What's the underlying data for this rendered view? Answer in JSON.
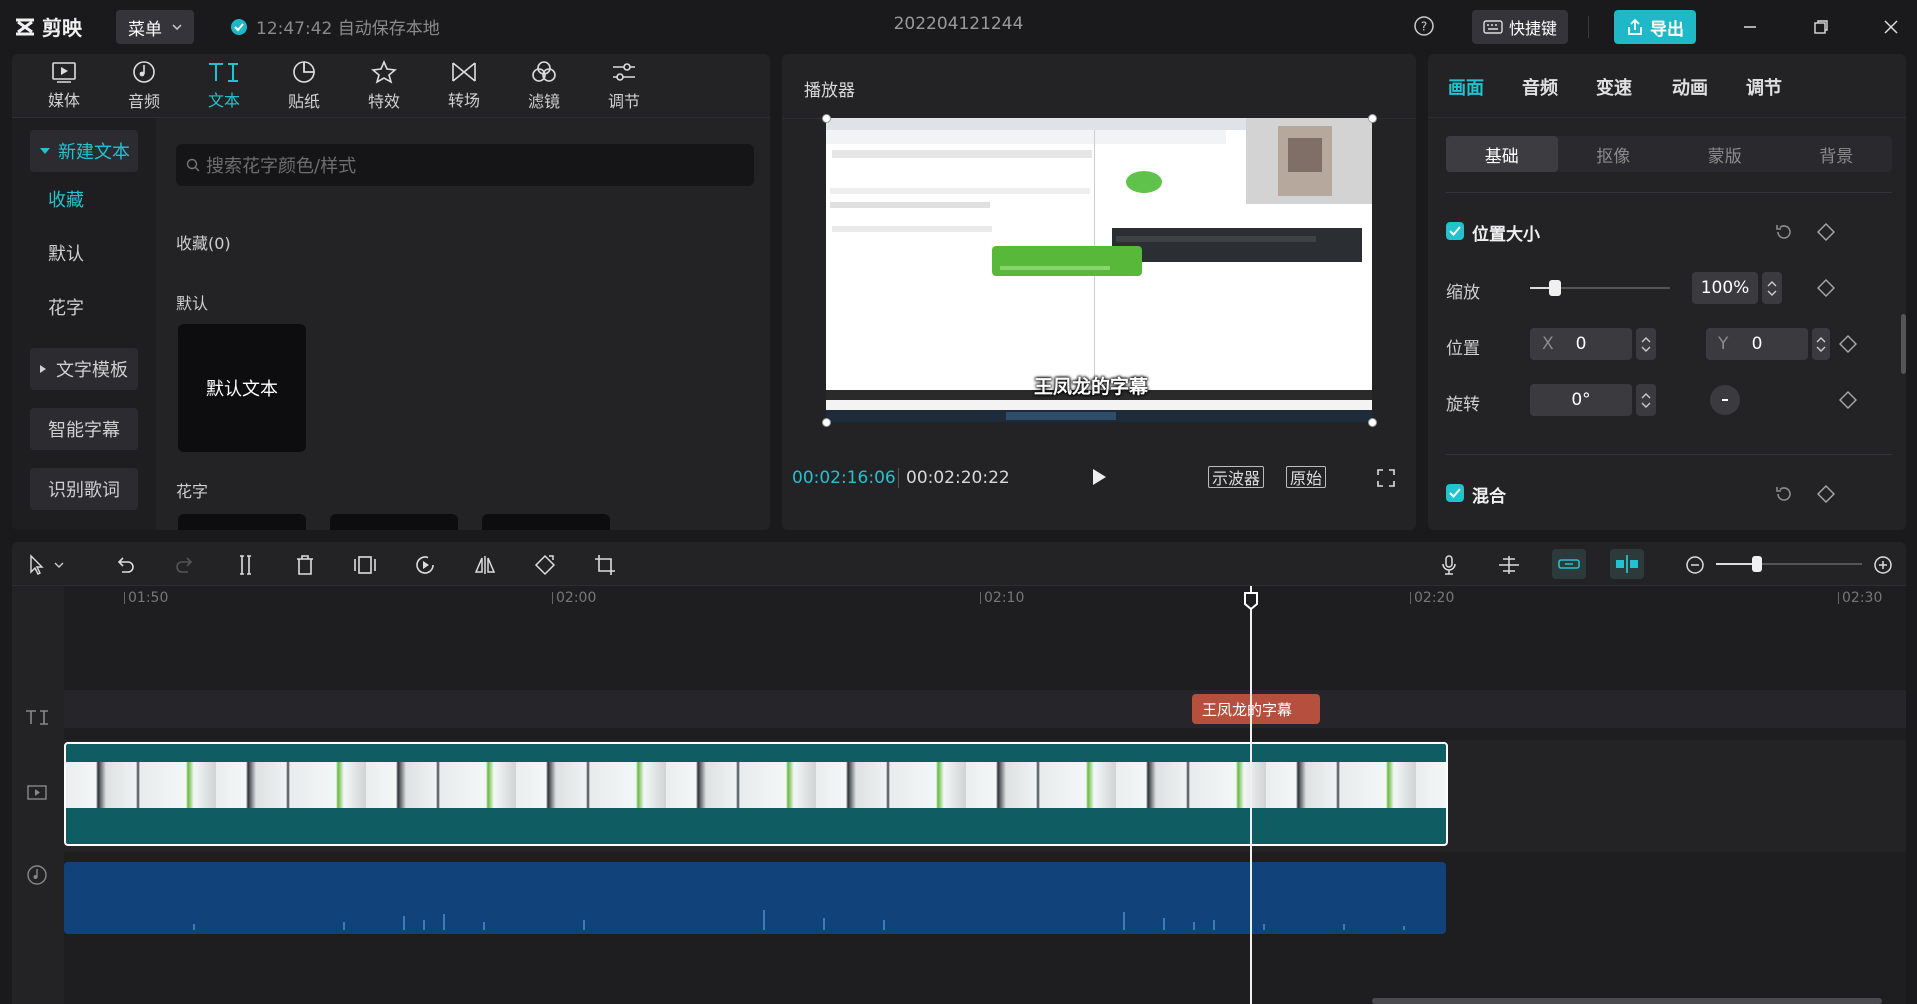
{
  "titlebar": {
    "app_name": "剪映",
    "menu_label": "菜单",
    "autosave_text": "12:47:42 自动保存本地",
    "project_title": "202204121244",
    "shortcut_label": "快捷键",
    "export_label": "导出",
    "accent_color": "#1fb8c8"
  },
  "media": {
    "tabs": [
      {
        "label": "媒体",
        "icon": "media-icon"
      },
      {
        "label": "音频",
        "icon": "audio-icon"
      },
      {
        "label": "文本",
        "icon": "text-icon",
        "active": true
      },
      {
        "label": "贴纸",
        "icon": "sticker-icon"
      },
      {
        "label": "特效",
        "icon": "effects-icon"
      },
      {
        "label": "转场",
        "icon": "transition-icon"
      },
      {
        "label": "滤镜",
        "icon": "filter-icon"
      },
      {
        "label": "调节",
        "icon": "adjust-icon"
      }
    ],
    "sidebar": [
      {
        "label": "新建文本",
        "expanded": true
      },
      {
        "label": "收藏",
        "active": true
      },
      {
        "label": "默认"
      },
      {
        "label": "花字"
      },
      {
        "label": "文字模板",
        "collapsed": true
      },
      {
        "label": "智能字幕"
      },
      {
        "label": "识别歌词"
      }
    ],
    "search_placeholder": "搜索花字颜色/样式",
    "sections": {
      "favorites": "收藏(0)",
      "default": "默认",
      "fancy": "花字"
    },
    "default_card_text": "默认文本"
  },
  "player": {
    "title": "播放器",
    "current_time": "00:02:16:06",
    "total_time": "00:02:20:22",
    "scope_label": "示波器",
    "original_label": "原始",
    "subtitle_text": "王凤龙的字幕"
  },
  "props": {
    "tabs": [
      "画面",
      "音频",
      "变速",
      "动画",
      "调节"
    ],
    "active_tab": "画面",
    "segments": [
      "基础",
      "抠像",
      "蒙版",
      "背景"
    ],
    "active_segment": "基础",
    "position_size": {
      "title": "位置大小",
      "scale_label": "缩放",
      "scale_value": "100%",
      "scale_fraction": 0.18,
      "position_label": "位置",
      "x_axis": "X",
      "x_value": "0",
      "y_axis": "Y",
      "y_value": "0",
      "rotation_label": "旋转",
      "rotation_value": "0°"
    },
    "blend": {
      "title": "混合"
    }
  },
  "timeline": {
    "ruler_labels": [
      "01:50",
      "02:00",
      "02:10",
      "02:20",
      "02:30"
    ],
    "text_clip_label": "王凤龙的字幕",
    "text_clip_color": "#b5503e",
    "video_clip_color": "#0f5d63",
    "audio_clip_color": "#12427a"
  }
}
